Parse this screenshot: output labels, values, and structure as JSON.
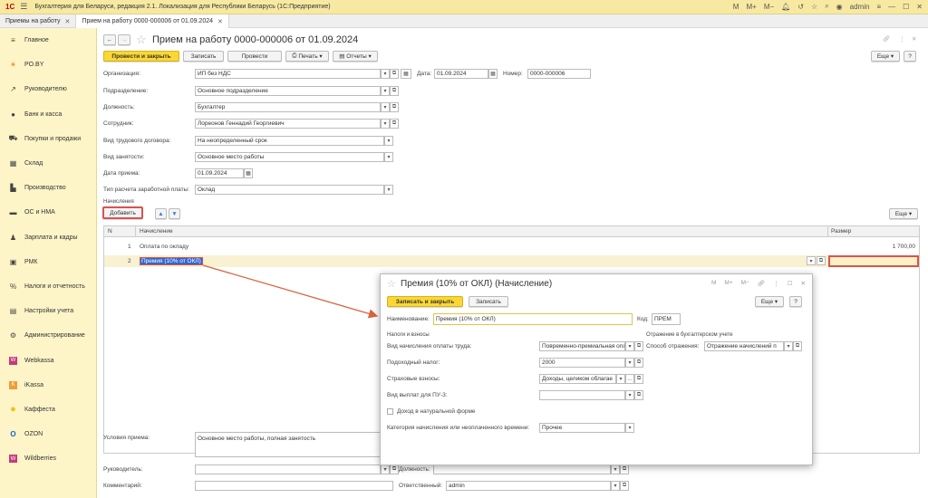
{
  "app": {
    "title": "Бухгалтерия для Беларуси, редакция 2.1. Локализация для Республики Беларусь   (1С:Предприятие)",
    "logo": "1С",
    "user": "admin",
    "top_m": "M",
    "top_mplus": "M+",
    "top_mminus": "M−"
  },
  "tabs": [
    {
      "label": "Приемы на работу"
    },
    {
      "label": "Прием на работу 0000-000006 от 01.09.2024"
    }
  ],
  "sidebar": {
    "items": [
      {
        "label": "Главное",
        "icon": "menu-icon",
        "g": "≡"
      },
      {
        "label": "PO.BY",
        "icon": "sun-icon",
        "g": "☀"
      },
      {
        "label": "Руководителю",
        "icon": "chart-icon",
        "g": "↗"
      },
      {
        "label": "Банк и касса",
        "icon": "coin-icon",
        "g": "●"
      },
      {
        "label": "Покупки и продажи",
        "icon": "cart-icon",
        "g": "⛟"
      },
      {
        "label": "Склад",
        "icon": "warehouse-icon",
        "g": "▦"
      },
      {
        "label": "Производство",
        "icon": "factory-icon",
        "g": "▙"
      },
      {
        "label": "ОС и НМА",
        "icon": "car-icon",
        "g": "▬"
      },
      {
        "label": "Зарплата и кадры",
        "icon": "people-icon",
        "g": "♟"
      },
      {
        "label": "РМК",
        "icon": "register-icon",
        "g": "▣"
      },
      {
        "label": "Налоги и отчетность",
        "icon": "tax-icon",
        "g": "%"
      },
      {
        "label": "Настройки учета",
        "icon": "settings-doc-icon",
        "g": "▤"
      },
      {
        "label": "Администрирование",
        "icon": "gear-icon",
        "g": "⚙"
      },
      {
        "label": "Webkassa",
        "icon": "webkassa-icon",
        "g": "W"
      },
      {
        "label": "iKassa",
        "icon": "ikassa-icon",
        "g": "K"
      },
      {
        "label": "Каффеста",
        "icon": "kaffesta-icon",
        "g": "●"
      },
      {
        "label": "OZON",
        "icon": "ozon-icon",
        "g": "O"
      },
      {
        "label": "Wildberries",
        "icon": "wildberries-icon",
        "g": "W"
      }
    ]
  },
  "doc": {
    "title": "Прием на работу 0000-000006 от 01.09.2024",
    "post_close": "Провести и закрыть",
    "save": "Записать",
    "post": "Провести",
    "print": "Печать",
    "reports": "Отчеты",
    "more": "Еще",
    "fields": {
      "org": {
        "label": "Организация:",
        "value": "ИП без НДС"
      },
      "date": {
        "label": "Дата:",
        "value": "01.09.2024"
      },
      "num": {
        "label": "Номер:",
        "value": "0000-000006"
      },
      "dept": {
        "label": "Подразделение:",
        "value": "Основное подразделение"
      },
      "pos": {
        "label": "Должность:",
        "value": "Бухгалтер"
      },
      "emp": {
        "label": "Сотрудник:",
        "value": "Лореонов Геннадий Георгиевич"
      },
      "contract": {
        "label": "Вид трудового договора:",
        "value": "На неопределенный срок"
      },
      "employment": {
        "label": "Вид занятости:",
        "value": "Основное место работы"
      },
      "hire_date": {
        "label": "Дата приема:",
        "value": "01.09.2024"
      },
      "pay_type": {
        "label": "Тип расчета заработной платы:",
        "value": "Оклад"
      }
    },
    "accruals_label": "Начисления",
    "add": "Добавить",
    "grid": {
      "col_n": "N",
      "col_name": "Начисление",
      "col_size": "Размер",
      "rows": [
        {
          "n": "1",
          "name": "Оплата по окладу",
          "size": "1 700,00"
        },
        {
          "n": "2",
          "name": "Премия (10% от ОКЛ)",
          "size": ""
        }
      ]
    },
    "conditions": {
      "label": "Условия приема:",
      "value": "Основное место работы, полная занятость"
    },
    "head": {
      "label": "Руководитель:",
      "value": ""
    },
    "head_pos": {
      "label": "Должность:",
      "value": ""
    },
    "comment": {
      "label": "Комментарий:",
      "value": ""
    },
    "responsible": {
      "label": "Ответственный:",
      "value": "admin"
    }
  },
  "dialog": {
    "title": "Премия (10% от ОКЛ) (Начисление)",
    "save_close": "Записать и закрыть",
    "save": "Записать",
    "more": "Еще",
    "help": "?",
    "name_label": "Наименование:",
    "name_value": "Премия (10% от ОКЛ)",
    "code_label": "Код:",
    "code_value": "ПРЕМ",
    "taxes_header": "Налоги и взносы",
    "acc_header": "Отражение в бухгалтерском учете",
    "pay_kind": {
      "label": "Вид начисления оплаты труда:",
      "value": "Повременно-премиальная опл"
    },
    "income_tax": {
      "label": "Подоходный налог:",
      "value": "2000"
    },
    "insurance": {
      "label": "Страховые взносы:",
      "value": "Доходы, целиком облагае"
    },
    "pu3": {
      "label": "Вид выплат для ПУ-3:",
      "value": ""
    },
    "in_kind": {
      "label": "Доход в натуральной форме"
    },
    "category": {
      "label": "Категория начисления или неоплаченного времени:",
      "value": "Прочее"
    },
    "reflect": {
      "label": "Способ отражения:",
      "value": "Отражение начислений п"
    }
  },
  "colors": {
    "accent": "#fbd735",
    "sidebar": "#fdf5c7",
    "highlight": "#d9534f",
    "arrow": "#d9633f"
  }
}
